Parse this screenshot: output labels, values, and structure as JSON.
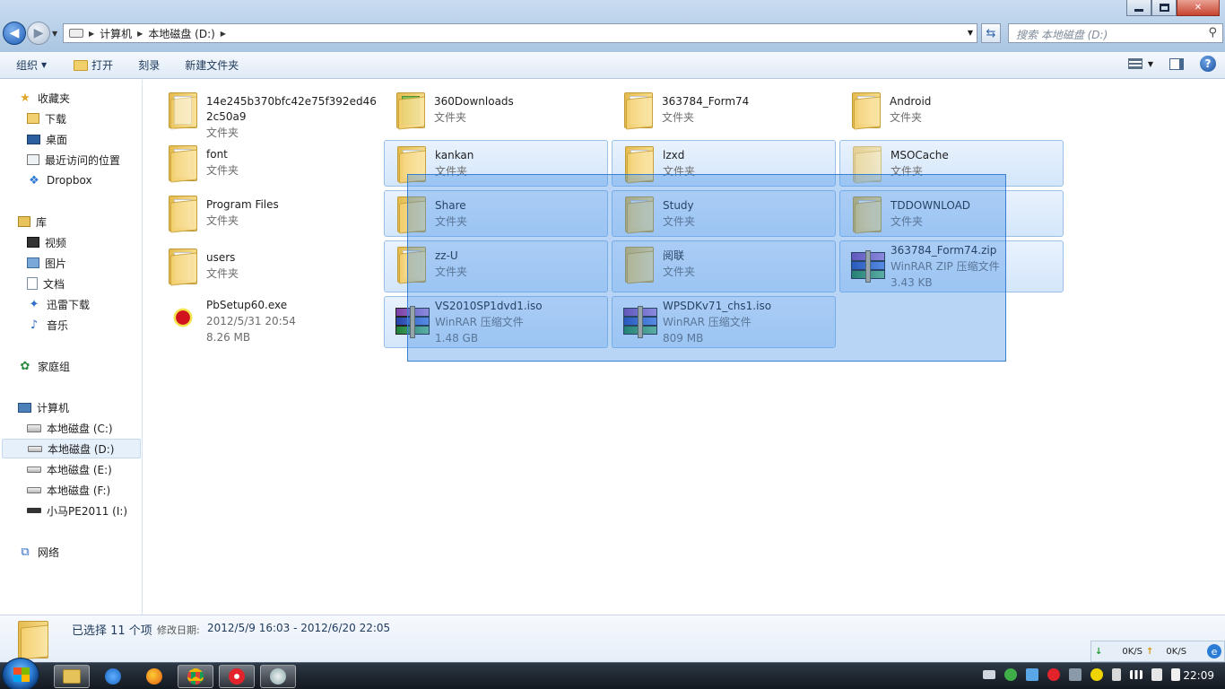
{
  "window": {
    "address": [
      "计算机",
      "本地磁盘 (D:)"
    ],
    "search_placeholder": "搜索 本地磁盘 (D:)"
  },
  "toolbar": {
    "organize": "组织",
    "open": "打开",
    "burn": "刻录",
    "new_folder": "新建文件夹"
  },
  "sidebar": {
    "favorites": {
      "title": "收藏夹",
      "items": [
        "下载",
        "桌面",
        "最近访问的位置",
        "Dropbox"
      ]
    },
    "libraries": {
      "title": "库",
      "items": [
        "视频",
        "图片",
        "文档",
        "迅雷下载",
        "音乐"
      ]
    },
    "homegroup": "家庭组",
    "computer": {
      "title": "计算机",
      "items": [
        "本地磁盘 (C:)",
        "本地磁盘 (D:)",
        "本地磁盘 (E:)",
        "本地磁盘 (F:)",
        "小马PE2011 (I:)"
      ]
    },
    "network": "网络"
  },
  "files": [
    {
      "name": "14e245b370bfc42e75f392ed462c50a9",
      "sub": "文件夹"
    },
    {
      "name": "360Downloads",
      "sub": "文件夹"
    },
    {
      "name": "363784_Form74",
      "sub": "文件夹"
    },
    {
      "name": "Android",
      "sub": "文件夹"
    },
    {
      "name": "font",
      "sub": "文件夹"
    },
    {
      "name": "kankan",
      "sub": "文件夹"
    },
    {
      "name": "lzxd",
      "sub": "文件夹"
    },
    {
      "name": "MSOCache",
      "sub": "文件夹"
    },
    {
      "name": "Program Files",
      "sub": "文件夹"
    },
    {
      "name": "Share",
      "sub": "文件夹"
    },
    {
      "name": "Study",
      "sub": "文件夹"
    },
    {
      "name": "TDDOWNLOAD",
      "sub": "文件夹"
    },
    {
      "name": "users",
      "sub": "文件夹"
    },
    {
      "name": "zz-U",
      "sub": "文件夹"
    },
    {
      "name": "阅联",
      "sub": "文件夹"
    },
    {
      "name": "363784_Form74.zip",
      "sub": "WinRAR ZIP 压缩文件",
      "size": "3.43 KB"
    },
    {
      "name": "PbSetup60.exe",
      "sub": "2012/5/31 20:54",
      "size": "8.26 MB"
    },
    {
      "name": "VS2010SP1dvd1.iso",
      "sub": "WinRAR 压缩文件",
      "size": "1.48 GB"
    },
    {
      "name": "WPSDKv71_chs1.iso",
      "sub": "WinRAR 压缩文件",
      "size": "809 MB"
    }
  ],
  "details": {
    "count_text": "已选择 11 个项",
    "date_label": "修改日期:",
    "date_range": "2012/5/9 16:03 - 2012/6/20 22:05"
  },
  "netspeed": {
    "down": "0K/S",
    "up": "0K/S"
  },
  "clock": "22:09"
}
